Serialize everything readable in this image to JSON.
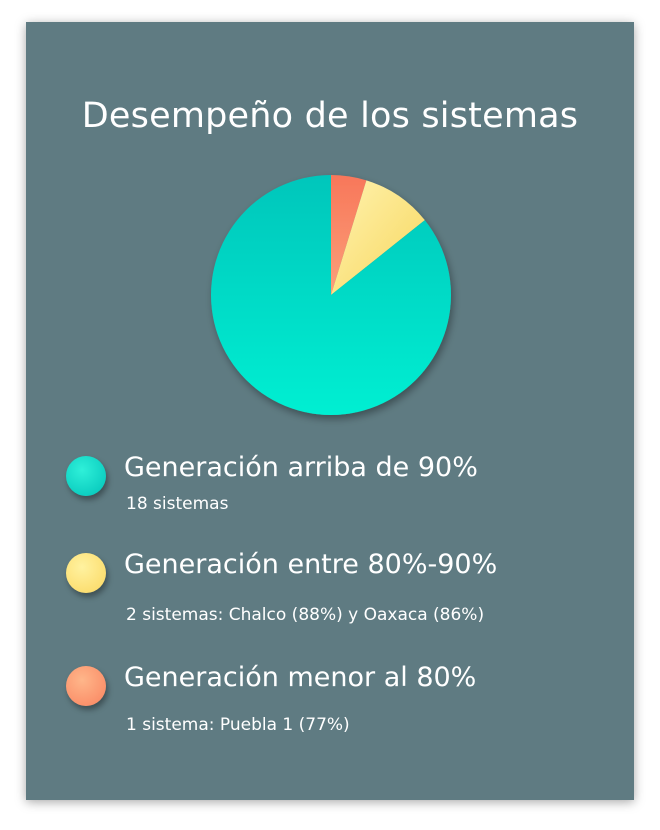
{
  "chart_data": {
    "type": "pie",
    "title": "Desempeño de los sistemas",
    "categories": [
      "Generación arriba de 90%",
      "Generación entre 80%-90%",
      "Generación menor al 80%"
    ],
    "values": [
      18,
      2,
      1
    ],
    "colors": [
      "#00d8c8",
      "#fbe27a",
      "#f9835f"
    ]
  },
  "legend": [
    {
      "label": "Generación arriba de 90%",
      "description": "18 sistemas"
    },
    {
      "label": "Generación entre 80%-90%",
      "description": "2 sistemas:  Chalco (88%) y Oaxaca (86%)"
    },
    {
      "label": "Generación menor al 80%",
      "description": "1 sistema: Puebla 1 (77%)"
    }
  ]
}
